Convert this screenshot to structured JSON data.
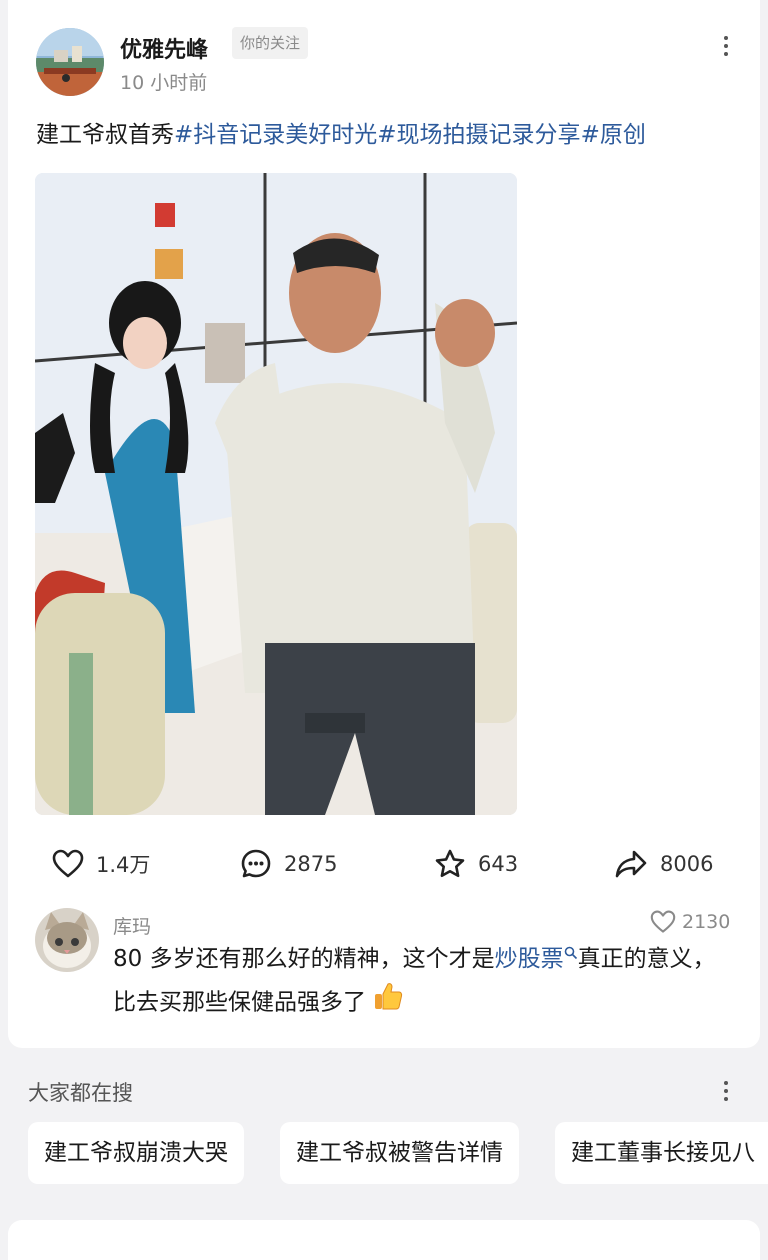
{
  "post": {
    "author": "优雅先峰",
    "follow_tag": "你的关注",
    "time": "10 小时前",
    "text_plain": "建工爷叔首秀",
    "hashtags": [
      "#抖音记录美好时光",
      "#现场拍摄记录分享",
      "#原创"
    ]
  },
  "actions": {
    "like": "1.4万",
    "comment": "2875",
    "favorite": "643",
    "share": "8006"
  },
  "comment": {
    "user": "库玛",
    "likes": "2130",
    "text_before": "80 多岁还有那么好的精神，这个才是",
    "keyword": "炒股票",
    "text_after": "真正的意义，比去买那些保健品强多了",
    "emoji": "thumbs-up"
  },
  "search": {
    "title": "大家都在搜",
    "items": [
      "建工爷叔崩溃大哭",
      "建工爷叔被警告详情",
      "建工董事长接见八"
    ]
  },
  "colors": {
    "link": "#2d5a9b",
    "page_background": "#f2f2f4",
    "muted_text": "#8a8a8a"
  },
  "icons": [
    "more-icon",
    "heart-icon",
    "comment-bubble-icon",
    "star-icon",
    "share-arrow-icon",
    "search-icon",
    "thumbs-up-emoji"
  ]
}
